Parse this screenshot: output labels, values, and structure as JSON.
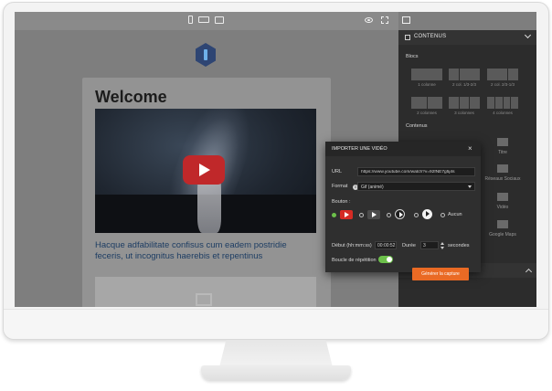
{
  "editor": {
    "email": {
      "title": "Welcome",
      "body_text": "Hacque adfabilitate confisus cum eadem postridie feceris, ut incognitus haerebis et repentinus"
    }
  },
  "side_panel": {
    "header": "CONTENUS",
    "blocs_label": "Blocs",
    "layouts": [
      {
        "caption": "1 colonne"
      },
      {
        "caption": "2 col. 1/3-2/3"
      },
      {
        "caption": "2 col. 2/3-1/3"
      },
      {
        "caption": "2 colonnes"
      },
      {
        "caption": "3 colonnes"
      },
      {
        "caption": "4 colonnes"
      }
    ],
    "contenus_label": "Contenus",
    "items": [
      {
        "label": "Titre"
      },
      {
        "label": "Réseaux Sociaux"
      },
      {
        "label": "Vidéo"
      },
      {
        "label": "Google Maps"
      }
    ]
  },
  "modal": {
    "title": "IMPORTER UNE VIDÉO",
    "close": "×",
    "url_label": "URL",
    "url_value": "https://www.youtube.com/watch?v=92fNE7g5j4s",
    "format_label": "Format",
    "info_glyph": "i",
    "format_value": "Gif (animé)",
    "bouton_label": "Bouton :",
    "aucun_label": "Aucun",
    "debut_label": "Début (hh:mm:ss)",
    "debut_value": "00:00:52",
    "duree_label": "Durée",
    "duree_value": "3",
    "secondes_label": "secondes",
    "loop_label": "Boucle de répétition",
    "generate_label": "Générer la capture"
  },
  "colors": {
    "accent_orange": "#ea6a24",
    "toggle_green": "#6cc04a",
    "youtube_red": "#d62b24",
    "panel_dark": "#2c2c2c"
  }
}
